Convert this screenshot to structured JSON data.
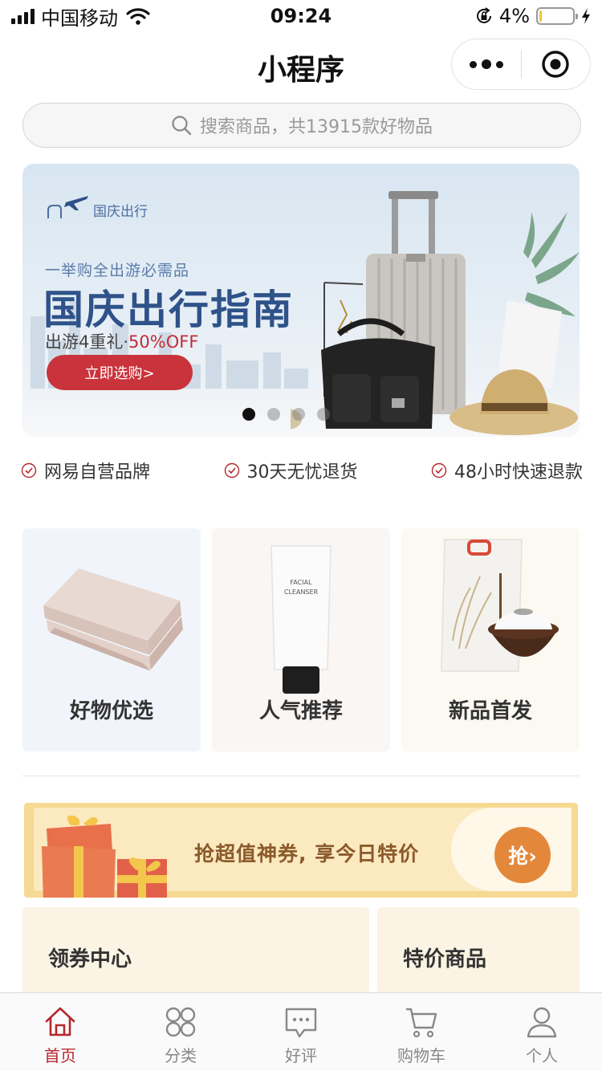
{
  "status_bar": {
    "carrier": "中国移动",
    "time": "09:24",
    "battery_percent_text": "4%",
    "battery_level": 0.04,
    "icons": [
      "signal-icon",
      "wifi-icon",
      "rotation-lock-icon",
      "battery-icon",
      "charging-icon"
    ]
  },
  "nav": {
    "title": "小程序",
    "capsule_icons": [
      "more-icon",
      "close-miniprogram-icon"
    ]
  },
  "search": {
    "placeholder": "搜索商品，共13915款好物品",
    "icon": "search-icon"
  },
  "banner": {
    "logo_text": "国庆出行",
    "subtitle": "一举购全出游必需品",
    "title": "国庆出行指南",
    "offer_prefix": "出游4重礼·",
    "offer_highlight": "50%OFF",
    "button_label": "立即选购>",
    "slide_count": 4,
    "active_slide": 1,
    "colors": {
      "title": "#2e5289",
      "button": "#c9333b",
      "highlight": "#c22d38"
    }
  },
  "promises": [
    {
      "label": "网易自营品牌",
      "icon": "check-circle-icon"
    },
    {
      "label": "30天无忧退货",
      "icon": "check-circle-icon"
    },
    {
      "label": "48小时快速退款",
      "icon": "check-circle-icon"
    }
  ],
  "categories": [
    {
      "label": "好物优选",
      "image": "folded-blanket"
    },
    {
      "label": "人气推荐",
      "image": "facial-cleanser-tube",
      "product_text": [
        "FACIAL",
        "CLEANSER"
      ]
    },
    {
      "label": "新品首发",
      "image": "rice-bag-and-bowl"
    }
  ],
  "coupon": {
    "text": "抢超值神券, 享今日特价",
    "button_label": "抢›",
    "icon": "gift-box-icon"
  },
  "cards": [
    {
      "label": "领券中心"
    },
    {
      "label": "特价商品"
    }
  ],
  "tab_bar": {
    "active_color": "#b4282d",
    "items": [
      {
        "label": "首页",
        "icon": "home-icon",
        "active": true
      },
      {
        "label": "分类",
        "icon": "category-icon",
        "active": false
      },
      {
        "label": "好评",
        "icon": "comment-icon",
        "active": false
      },
      {
        "label": "购物车",
        "icon": "cart-icon",
        "active": false
      },
      {
        "label": "个人",
        "icon": "user-icon",
        "active": false
      }
    ]
  }
}
